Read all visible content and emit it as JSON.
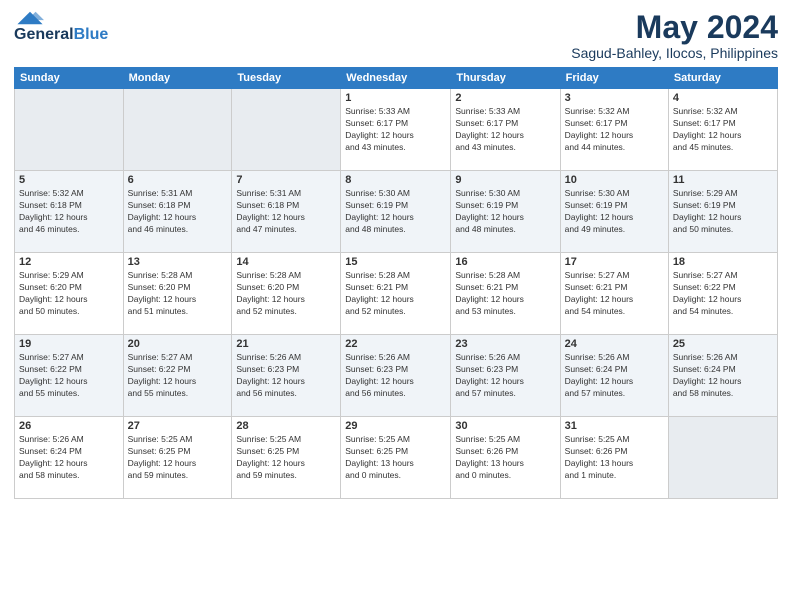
{
  "logo": {
    "general": "General",
    "blue": "Blue"
  },
  "header": {
    "month": "May 2024",
    "location": "Sagud-Bahley, Ilocos, Philippines"
  },
  "weekdays": [
    "Sunday",
    "Monday",
    "Tuesday",
    "Wednesday",
    "Thursday",
    "Friday",
    "Saturday"
  ],
  "weeks": [
    [
      {
        "day": "",
        "info": ""
      },
      {
        "day": "",
        "info": ""
      },
      {
        "day": "",
        "info": ""
      },
      {
        "day": "1",
        "info": "Sunrise: 5:33 AM\nSunset: 6:17 PM\nDaylight: 12 hours\nand 43 minutes."
      },
      {
        "day": "2",
        "info": "Sunrise: 5:33 AM\nSunset: 6:17 PM\nDaylight: 12 hours\nand 43 minutes."
      },
      {
        "day": "3",
        "info": "Sunrise: 5:32 AM\nSunset: 6:17 PM\nDaylight: 12 hours\nand 44 minutes."
      },
      {
        "day": "4",
        "info": "Sunrise: 5:32 AM\nSunset: 6:17 PM\nDaylight: 12 hours\nand 45 minutes."
      }
    ],
    [
      {
        "day": "5",
        "info": "Sunrise: 5:32 AM\nSunset: 6:18 PM\nDaylight: 12 hours\nand 46 minutes."
      },
      {
        "day": "6",
        "info": "Sunrise: 5:31 AM\nSunset: 6:18 PM\nDaylight: 12 hours\nand 46 minutes."
      },
      {
        "day": "7",
        "info": "Sunrise: 5:31 AM\nSunset: 6:18 PM\nDaylight: 12 hours\nand 47 minutes."
      },
      {
        "day": "8",
        "info": "Sunrise: 5:30 AM\nSunset: 6:19 PM\nDaylight: 12 hours\nand 48 minutes."
      },
      {
        "day": "9",
        "info": "Sunrise: 5:30 AM\nSunset: 6:19 PM\nDaylight: 12 hours\nand 48 minutes."
      },
      {
        "day": "10",
        "info": "Sunrise: 5:30 AM\nSunset: 6:19 PM\nDaylight: 12 hours\nand 49 minutes."
      },
      {
        "day": "11",
        "info": "Sunrise: 5:29 AM\nSunset: 6:19 PM\nDaylight: 12 hours\nand 50 minutes."
      }
    ],
    [
      {
        "day": "12",
        "info": "Sunrise: 5:29 AM\nSunset: 6:20 PM\nDaylight: 12 hours\nand 50 minutes."
      },
      {
        "day": "13",
        "info": "Sunrise: 5:28 AM\nSunset: 6:20 PM\nDaylight: 12 hours\nand 51 minutes."
      },
      {
        "day": "14",
        "info": "Sunrise: 5:28 AM\nSunset: 6:20 PM\nDaylight: 12 hours\nand 52 minutes."
      },
      {
        "day": "15",
        "info": "Sunrise: 5:28 AM\nSunset: 6:21 PM\nDaylight: 12 hours\nand 52 minutes."
      },
      {
        "day": "16",
        "info": "Sunrise: 5:28 AM\nSunset: 6:21 PM\nDaylight: 12 hours\nand 53 minutes."
      },
      {
        "day": "17",
        "info": "Sunrise: 5:27 AM\nSunset: 6:21 PM\nDaylight: 12 hours\nand 54 minutes."
      },
      {
        "day": "18",
        "info": "Sunrise: 5:27 AM\nSunset: 6:22 PM\nDaylight: 12 hours\nand 54 minutes."
      }
    ],
    [
      {
        "day": "19",
        "info": "Sunrise: 5:27 AM\nSunset: 6:22 PM\nDaylight: 12 hours\nand 55 minutes."
      },
      {
        "day": "20",
        "info": "Sunrise: 5:27 AM\nSunset: 6:22 PM\nDaylight: 12 hours\nand 55 minutes."
      },
      {
        "day": "21",
        "info": "Sunrise: 5:26 AM\nSunset: 6:23 PM\nDaylight: 12 hours\nand 56 minutes."
      },
      {
        "day": "22",
        "info": "Sunrise: 5:26 AM\nSunset: 6:23 PM\nDaylight: 12 hours\nand 56 minutes."
      },
      {
        "day": "23",
        "info": "Sunrise: 5:26 AM\nSunset: 6:23 PM\nDaylight: 12 hours\nand 57 minutes."
      },
      {
        "day": "24",
        "info": "Sunrise: 5:26 AM\nSunset: 6:24 PM\nDaylight: 12 hours\nand 57 minutes."
      },
      {
        "day": "25",
        "info": "Sunrise: 5:26 AM\nSunset: 6:24 PM\nDaylight: 12 hours\nand 58 minutes."
      }
    ],
    [
      {
        "day": "26",
        "info": "Sunrise: 5:26 AM\nSunset: 6:24 PM\nDaylight: 12 hours\nand 58 minutes."
      },
      {
        "day": "27",
        "info": "Sunrise: 5:25 AM\nSunset: 6:25 PM\nDaylight: 12 hours\nand 59 minutes."
      },
      {
        "day": "28",
        "info": "Sunrise: 5:25 AM\nSunset: 6:25 PM\nDaylight: 12 hours\nand 59 minutes."
      },
      {
        "day": "29",
        "info": "Sunrise: 5:25 AM\nSunset: 6:25 PM\nDaylight: 13 hours\nand 0 minutes."
      },
      {
        "day": "30",
        "info": "Sunrise: 5:25 AM\nSunset: 6:26 PM\nDaylight: 13 hours\nand 0 minutes."
      },
      {
        "day": "31",
        "info": "Sunrise: 5:25 AM\nSunset: 6:26 PM\nDaylight: 13 hours\nand 1 minute."
      },
      {
        "day": "",
        "info": ""
      }
    ]
  ]
}
